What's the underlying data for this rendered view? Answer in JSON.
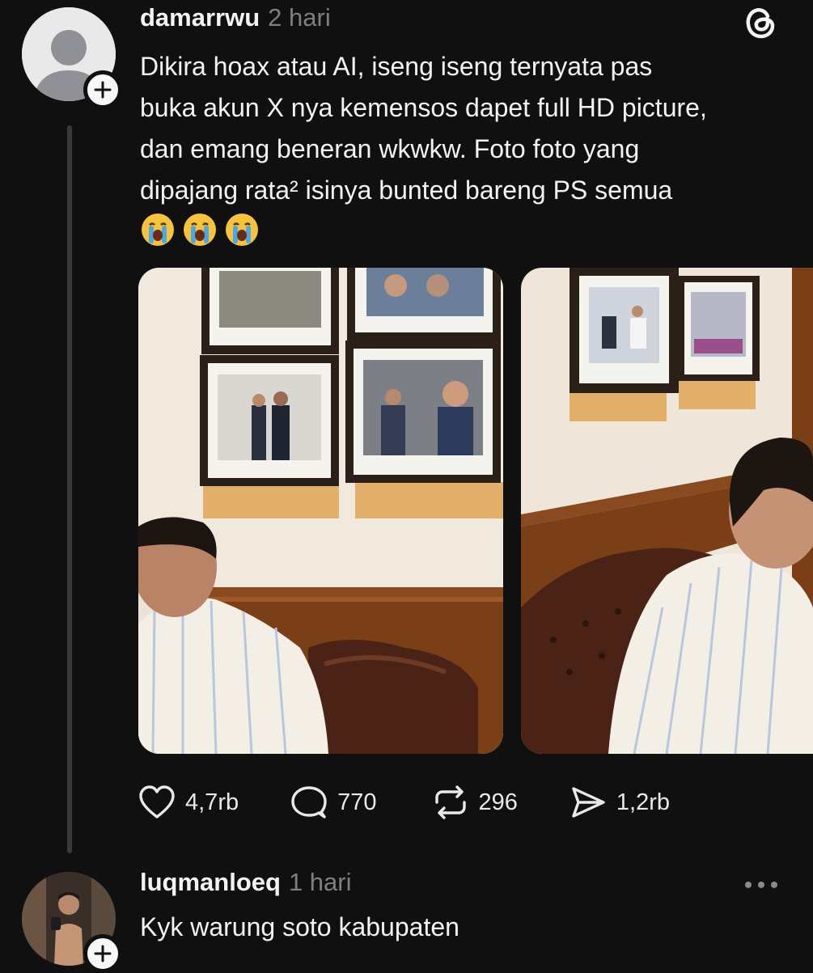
{
  "post": {
    "username": "damarrwu",
    "time": "2 hari",
    "text_lines": [
      "Dikira hoax atau AI, iseng iseng ternyata pas",
      "buka akun X nya kemensos dapet full HD picture,",
      "dan emang beneran wkwkw. Foto foto yang",
      "dipajang rata² isinya bunted bareng PS semua"
    ],
    "emojis": [
      "loudly-crying-face",
      "loudly-crying-face",
      "loudly-crying-face"
    ],
    "actions": {
      "likes": "4,7rb",
      "replies": "770",
      "reposts": "296",
      "shares": "1,2rb"
    }
  },
  "reply": {
    "username": "luqmanloeq",
    "time": "1 hari",
    "text": "Kyk warung soto kabupaten"
  },
  "icons": {
    "app": "threads-icon",
    "like": "heart-icon",
    "reply": "comment-icon",
    "repost": "repost-icon",
    "share": "send-icon",
    "more": "more-icon",
    "follow": "plus-icon"
  },
  "colors": {
    "background": "#101010",
    "text": "#f3f3f3",
    "muted": "#7f7f7f"
  }
}
